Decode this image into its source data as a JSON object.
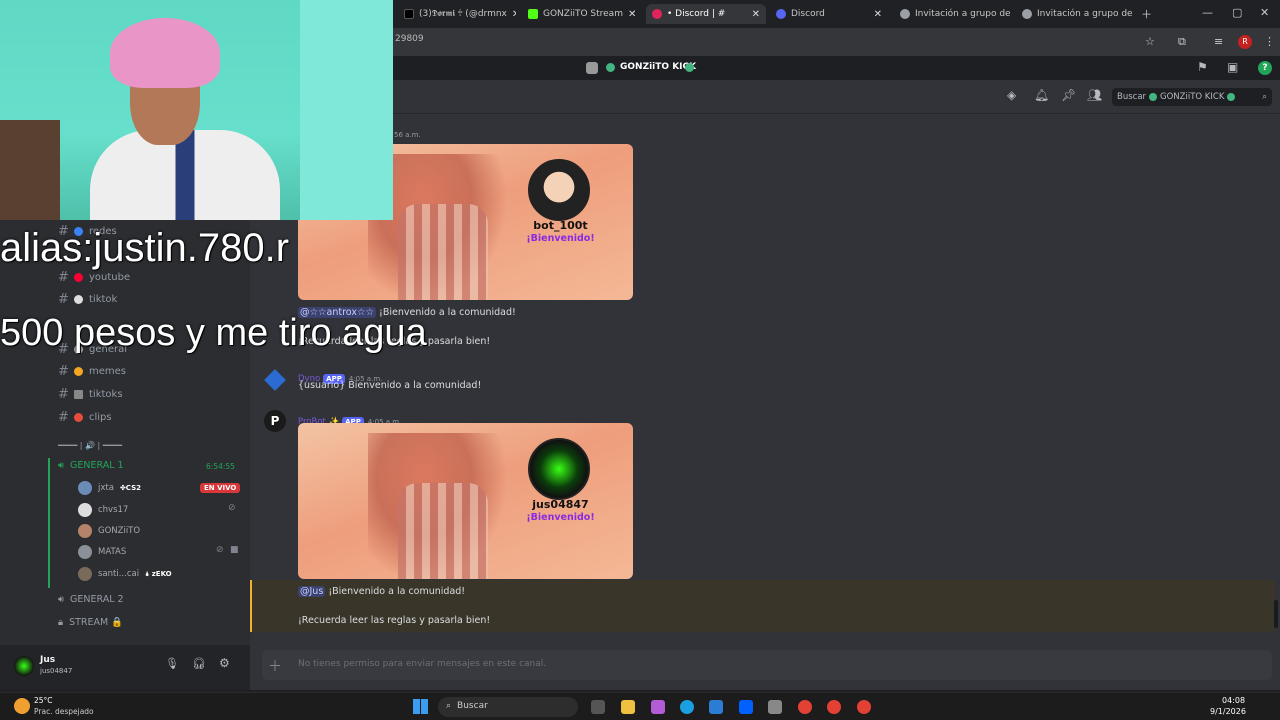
{
  "browser": {
    "tabs": [
      {
        "label": "(3)𝕯𝖔𝖗𝖒𝖎 🕆 (@drmnx",
        "color": "#000000"
      },
      {
        "label": "GONZiiTO Stream",
        "color": "#53fc18"
      },
      {
        "label": "• Discord | #",
        "color": "#e2245c"
      },
      {
        "label": "Discord",
        "color": "#5865f2"
      },
      {
        "label": "Invitación a grupo de",
        "color": "#9aa0a6"
      },
      {
        "label": "Invitación a grupo de",
        "color": "#9aa0a6"
      }
    ],
    "url_fragment": "29809",
    "profile_initial": "R"
  },
  "discord": {
    "server_title": "GONZiiTO KICK",
    "search_placeholder": "Buscar",
    "search_server": "GONZiiTO KICK",
    "channels": [
      {
        "name": "redes",
        "color": "#3b82f6"
      },
      {
        "name": "youtube",
        "color": "#ff0033"
      },
      {
        "name": "tiktok",
        "color": "#dddddd"
      },
      {
        "name": "general",
        "color": "#aaaaaa"
      },
      {
        "name": "memes",
        "color": "#f5a623"
      },
      {
        "name": "tiktoks",
        "color": "#888888"
      },
      {
        "name": "clips",
        "color": "#e74c3c"
      }
    ],
    "divider_label": "━━━━ | 🔊 | ━━━━",
    "voice": {
      "channel1": "GENERAL 1",
      "channel1_time": "6:54:55",
      "users": [
        {
          "name": "jxta",
          "tag": "✤CS2",
          "badge": "EN VIVO"
        },
        {
          "name": "chvs17",
          "tag": "",
          "badge": ""
        },
        {
          "name": "GONZiiTO",
          "tag": "",
          "badge": ""
        },
        {
          "name": "MATAS",
          "tag": "",
          "badge": ""
        },
        {
          "name": "santi...cai",
          "tag": "🌢 zEKO",
          "badge": ""
        }
      ],
      "channel2": "GENERAL 2",
      "channel3": "STREAM 🔒"
    },
    "user": {
      "name": "Jus",
      "handle": "jus04847"
    },
    "messages": {
      "timestamp_top": "56 a.m.",
      "banner1": {
        "user": "bot_100t",
        "welcome": "¡Bienvenido!"
      },
      "mention1": "@☆☆antrox☆☆",
      "welcome_text": "¡Bienvenido a la comunidad!",
      "rules_text": "¡Recuerda leer las reglas y pasarla bien!",
      "dyno_name": "Dyno",
      "app_tag": "APP",
      "dyno_time": "4:05 a.m.",
      "dyno_text": "{usuario} Bienvenido a la comunidad!",
      "probot_name": "ProBot ✨",
      "probot_time": "4:05 a.m.",
      "banner2": {
        "user": "jus04847",
        "welcome": "¡Bienvenido!"
      },
      "mention2": "@Jus",
      "input_placeholder": "No tienes permiso para enviar mensajes en este canal."
    }
  },
  "overlay": {
    "line1": "alias:justin.780.r",
    "line2": "500 pesos y me tiro agua"
  },
  "taskbar": {
    "weather_temp": "25°C",
    "weather_desc": "Prac. despejado",
    "search": "Buscar",
    "time": "04:08",
    "date": "9/1/2026"
  }
}
